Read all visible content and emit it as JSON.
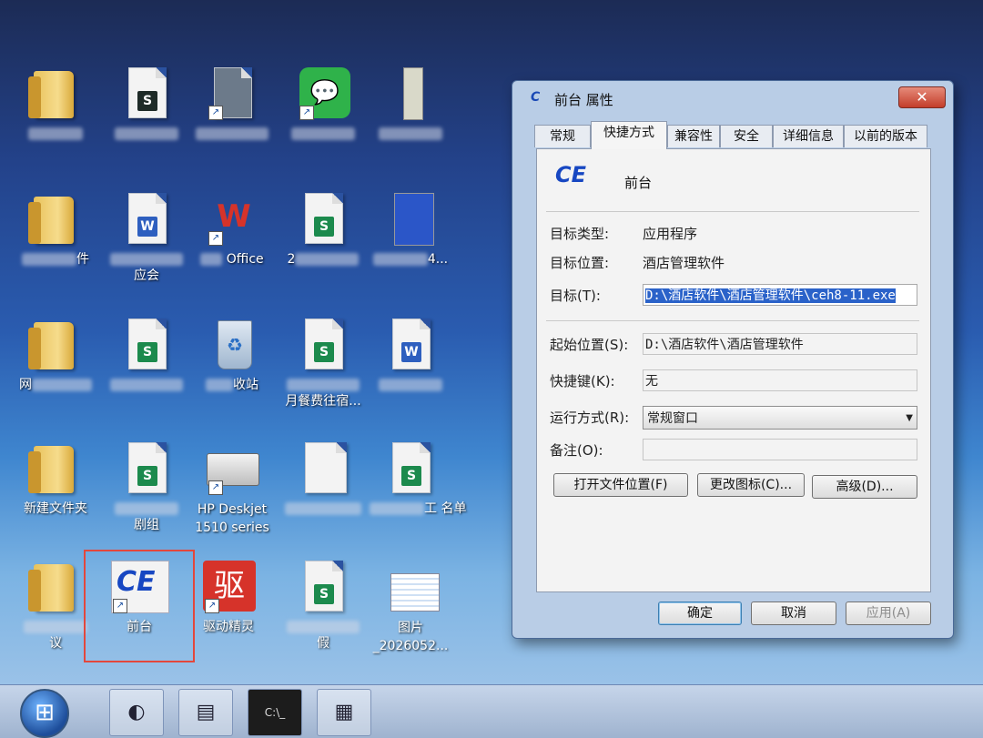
{
  "desktop": {
    "icons": [
      {
        "label": "",
        "type": "folder"
      },
      {
        "label": "",
        "type": "sheet",
        "badge": "S"
      },
      {
        "label": "",
        "type": "app"
      },
      {
        "label": "",
        "type": "wechat"
      },
      {
        "label": "",
        "type": "app"
      },
      {
        "label": "件",
        "type": "folder"
      },
      {
        "label": "应会",
        "type": "doc",
        "badge": "W"
      },
      {
        "label": "Office",
        "type": "wps"
      },
      {
        "label": "2",
        "type": "sheet",
        "badge": "S"
      },
      {
        "label": "4...",
        "type": "image"
      },
      {
        "label": "网",
        "type": "folder"
      },
      {
        "label": "",
        "type": "sheet",
        "badge": "S"
      },
      {
        "label": "收站",
        "type": "recycle"
      },
      {
        "label": "月餐费往宿...",
        "type": "sheet",
        "badge": "S"
      },
      {
        "label": "",
        "type": "doc",
        "badge": "W"
      },
      {
        "label": "新建文件夹",
        "type": "folder"
      },
      {
        "label": "剧组",
        "type": "sheet",
        "badge": "S"
      },
      {
        "label": "HP Deskjet 1510 series",
        "type": "printer"
      },
      {
        "label": "",
        "type": "blank"
      },
      {
        "label": "工 名单",
        "type": "sheet",
        "badge": "S"
      },
      {
        "label": "议",
        "type": "folder"
      },
      {
        "label": "前台",
        "type": "ce-app",
        "badge": "CE"
      },
      {
        "label": "驱动精灵",
        "type": "driver",
        "badge": "驱"
      },
      {
        "label": "假",
        "type": "sheet",
        "badge": "S"
      },
      {
        "label": "图片 _2026052...",
        "type": "image"
      }
    ]
  },
  "taskbar": {
    "start": "start-orb",
    "items": [
      "browser",
      "explorer",
      "cmd",
      "photos"
    ],
    "cmd_text": "C:\\_"
  },
  "dialog": {
    "title": "前台 属性",
    "close_label": "✕",
    "tabs": [
      "常规",
      "快捷方式",
      "兼容性",
      "安全",
      "详细信息",
      "以前的版本"
    ],
    "active_tab": "快捷方式",
    "app_icon_text": "CE",
    "app_name": "前台",
    "fields": {
      "target_type_label": "目标类型:",
      "target_type_value": "应用程序",
      "target_location_label": "目标位置:",
      "target_location_value": "酒店管理软件",
      "target_label": "目标(T):",
      "target_value": "D:\\酒店软件\\酒店管理软件\\ceh8-11.exe",
      "start_in_label": "起始位置(S):",
      "start_in_value": "D:\\酒店软件\\酒店管理软件",
      "shortcut_key_label": "快捷键(K):",
      "shortcut_key_value": "无",
      "run_label": "运行方式(R):",
      "run_value": "常规窗口",
      "comment_label": "备注(O):",
      "comment_value": ""
    },
    "buttons": {
      "open_location": "打开文件位置(F)",
      "change_icon": "更改图标(C)...",
      "advanced": "高级(D)...",
      "ok": "确定",
      "cancel": "取消",
      "apply": "应用(A)"
    }
  }
}
